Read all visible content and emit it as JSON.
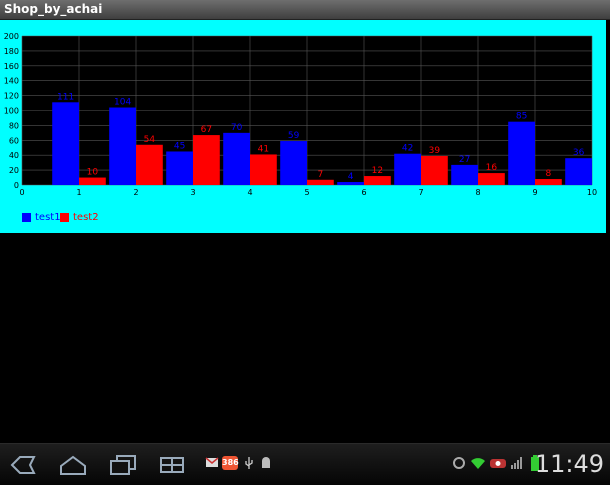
{
  "window": {
    "title": "Shop_by_achai"
  },
  "chart_data": {
    "type": "bar",
    "x": [
      1,
      2,
      3,
      4,
      5,
      6,
      7,
      8,
      9,
      10
    ],
    "xticks": [
      "0",
      "1",
      "2",
      "3",
      "4",
      "5",
      "6",
      "7",
      "8",
      "9",
      "10"
    ],
    "yticks": [
      "0",
      "20",
      "40",
      "60",
      "80",
      "100",
      "120",
      "140",
      "160",
      "180",
      "200"
    ],
    "xlim": [
      0,
      10
    ],
    "ylim": [
      0,
      200
    ],
    "grid": true,
    "legend_position": "bottom-left",
    "series": [
      {
        "name": "test1",
        "color": "#0000ff",
        "values": [
          111,
          104,
          45,
          70,
          59,
          4,
          42,
          27,
          85,
          36
        ]
      },
      {
        "name": "test2",
        "color": "#ff0000",
        "values": [
          10,
          54,
          67,
          41,
          7,
          12,
          39,
          16,
          8
        ]
      }
    ]
  },
  "statusbar": {
    "time": "11:49",
    "notification_count": "386"
  },
  "icons": {
    "back": "back-icon",
    "home": "home-icon",
    "recent": "recent-apps-icon",
    "menu": "menu-icon",
    "gmail": "mail-icon",
    "usb": "usb-icon",
    "android": "android-debug-icon",
    "sync": "sync-icon",
    "wifi": "wifi-icon",
    "signal": "signal-icon",
    "battery": "battery-icon"
  }
}
